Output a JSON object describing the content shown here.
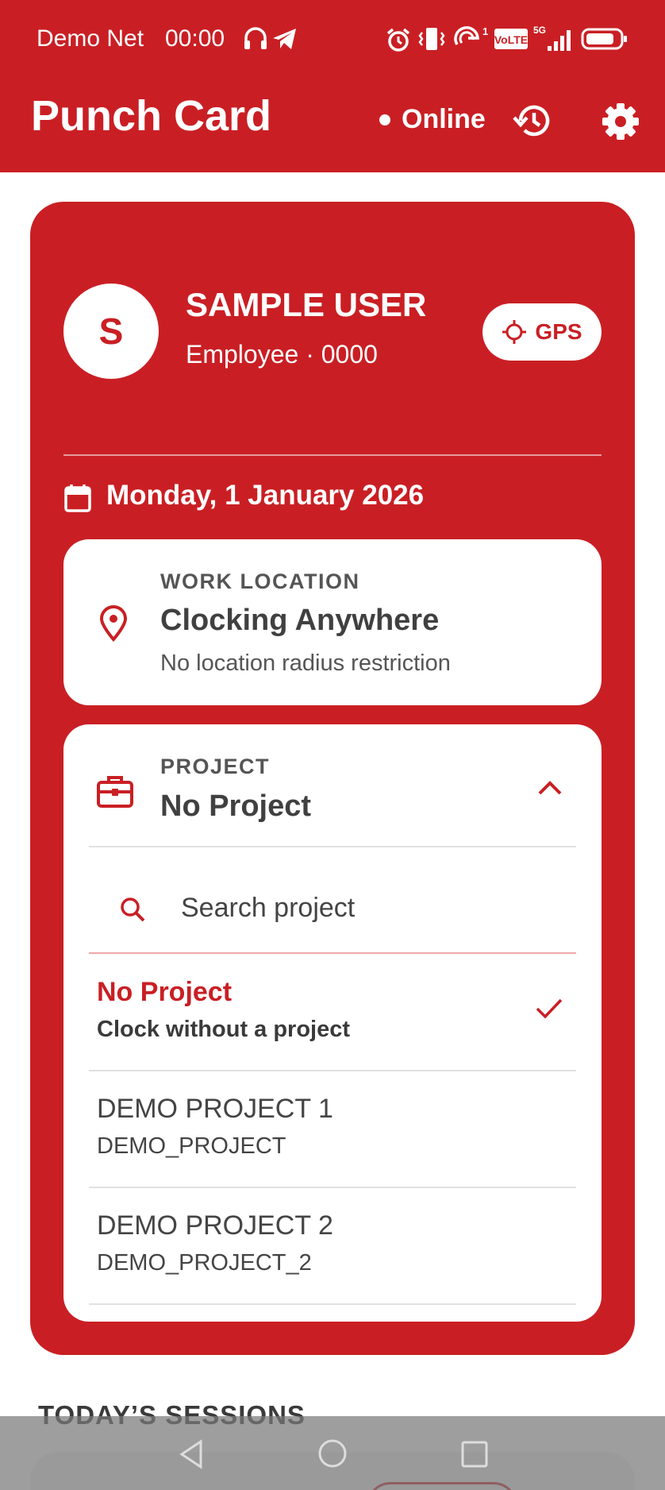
{
  "status_bar": {
    "carrier": "Demo Net",
    "time": "00:00",
    "network": "5G",
    "volte": "VoLTE",
    "sim_slot": "1"
  },
  "header": {
    "title": "Punch Card",
    "status": "Online"
  },
  "user": {
    "initial": "S",
    "name": "SAMPLE USER",
    "role": "Employee · 0000",
    "gps_label": "GPS"
  },
  "date": "Monday, 1 January 2026",
  "work_location": {
    "label": "WORK LOCATION",
    "title": "Clocking Anywhere",
    "subtitle": "No location radius restriction"
  },
  "project": {
    "label": "PROJECT",
    "selected": "No Project",
    "search_placeholder": "Search project",
    "options": [
      {
        "title": "No Project",
        "subtitle": "Clock without a project",
        "selected": true
      },
      {
        "title": "DEMO PROJECT 1",
        "subtitle": "DEMO_PROJECT",
        "selected": false
      },
      {
        "title": "DEMO PROJECT 2",
        "subtitle": "DEMO_PROJECT_2",
        "selected": false
      }
    ]
  },
  "sessions": {
    "title": "TODAY’S SESSIONS"
  },
  "colors": {
    "brand_red": "#c91f24",
    "card_white": "#ffffff",
    "text_dark": "#404040"
  }
}
